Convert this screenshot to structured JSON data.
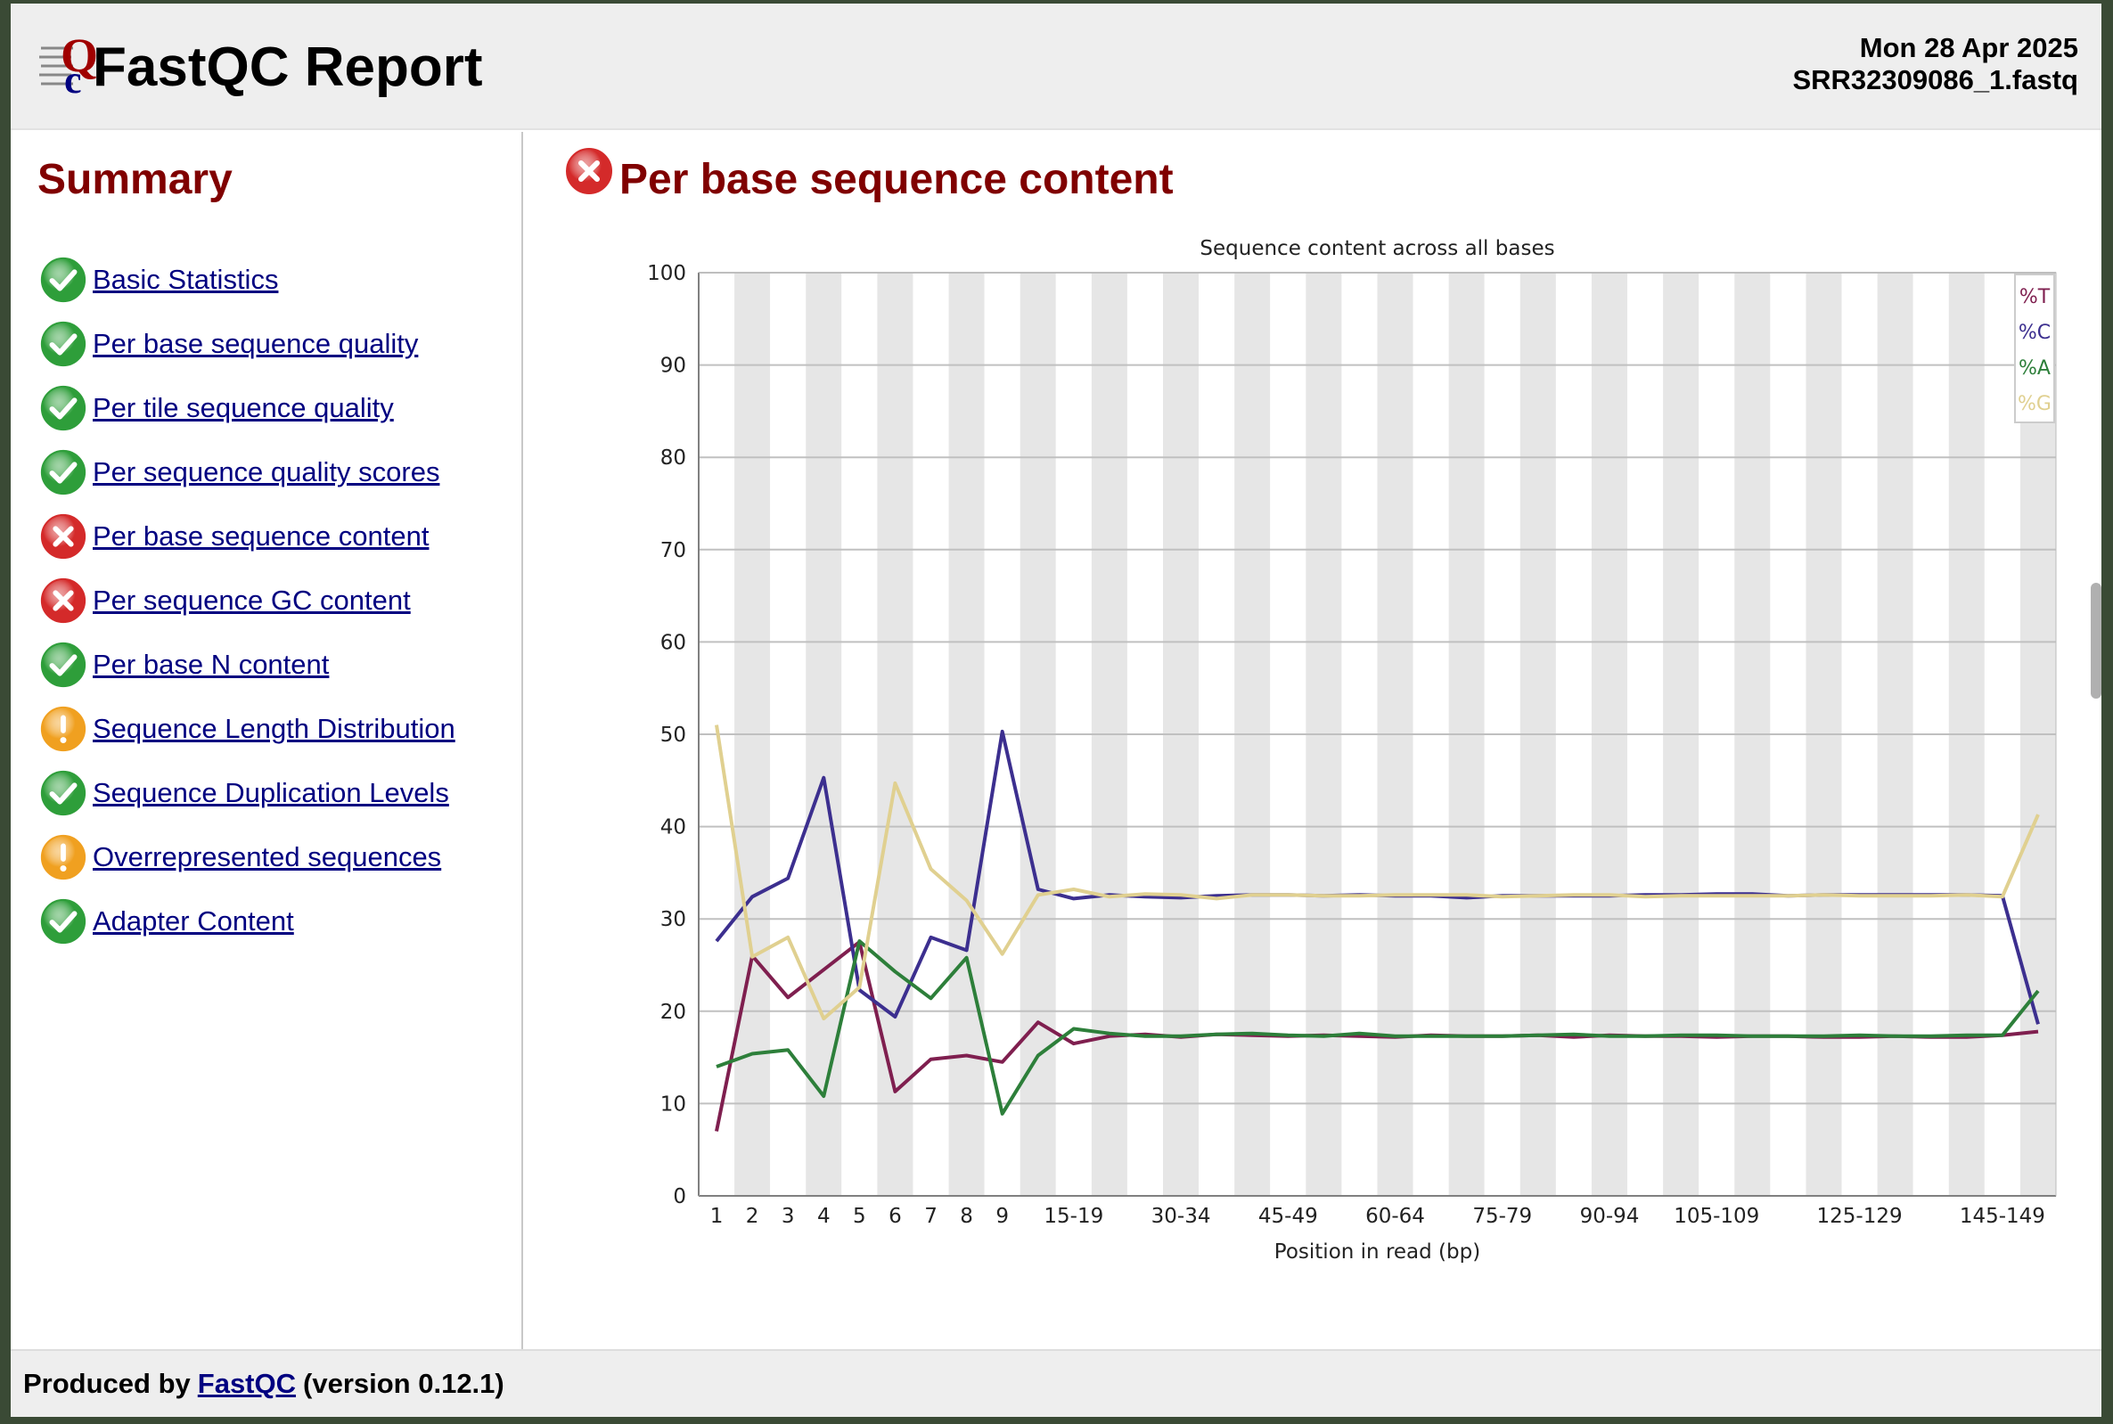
{
  "header": {
    "title": "FastQC Report",
    "date": "Mon 28 Apr 2025",
    "filename": "SRR32309086_1.fastq"
  },
  "sidebar": {
    "title": "Summary",
    "items": [
      {
        "label": "Basic Statistics",
        "status": "pass"
      },
      {
        "label": "Per base sequence quality",
        "status": "pass"
      },
      {
        "label": "Per tile sequence quality",
        "status": "pass"
      },
      {
        "label": "Per sequence quality scores",
        "status": "pass"
      },
      {
        "label": "Per base sequence content",
        "status": "fail"
      },
      {
        "label": "Per sequence GC content",
        "status": "fail"
      },
      {
        "label": "Per base N content",
        "status": "pass"
      },
      {
        "label": "Sequence Length Distribution",
        "status": "warn"
      },
      {
        "label": "Sequence Duplication Levels",
        "status": "pass"
      },
      {
        "label": "Overrepresented sequences",
        "status": "warn"
      },
      {
        "label": "Adapter Content",
        "status": "pass"
      }
    ]
  },
  "module": {
    "title": "Per base sequence content",
    "status": "fail"
  },
  "footer": {
    "produced_by": "Produced by",
    "link": "FastQC",
    "version": "(version 0.12.1)"
  },
  "colors": {
    "pass": "#2e9e3a",
    "fail": "#d42a2a",
    "warn": "#f0a020",
    "T": "#7f1f4f",
    "C": "#3c2f8f",
    "A": "#2d7f3a",
    "G": "#e0d090"
  },
  "chart_data": {
    "type": "line",
    "title": "Sequence content across all bases",
    "xlabel": "Position in read (bp)",
    "ylabel": "",
    "ylim": [
      0,
      100
    ],
    "yticks": [
      0,
      10,
      20,
      30,
      40,
      50,
      60,
      70,
      80,
      90,
      100
    ],
    "grid": true,
    "legend": "top-right",
    "categories": [
      "1",
      "2",
      "3",
      "4",
      "5",
      "6",
      "7",
      "8",
      "9",
      "10-14",
      "15-19",
      "20-24",
      "25-29",
      "30-34",
      "35-39",
      "40-44",
      "45-49",
      "50-54",
      "55-59",
      "60-64",
      "65-69",
      "70-74",
      "75-79",
      "80-84",
      "85-89",
      "90-94",
      "95-99",
      "100-104",
      "105-109",
      "110-114",
      "115-119",
      "120-124",
      "125-129",
      "130-134",
      "135-139",
      "140-144",
      "145-149",
      "150-151"
    ],
    "tick_labels": [
      "1",
      "2",
      "3",
      "4",
      "5",
      "6",
      "7",
      "8",
      "9",
      "",
      "15-19",
      "",
      "30-34",
      "",
      "45-49",
      "",
      "60-64",
      "",
      "75-79",
      "",
      "90-94",
      "",
      "105-109",
      "",
      "125-129",
      "",
      "145-149"
    ],
    "tick_at": [
      "1",
      "2",
      "3",
      "4",
      "5",
      "6",
      "7",
      "8",
      "9",
      "10-14",
      "15-19",
      "25-29",
      "30-34",
      "40-44",
      "45-49",
      "55-59",
      "60-64",
      "70-74",
      "75-79",
      "85-89",
      "90-94",
      "100-104",
      "105-109",
      "115-119",
      "125-129",
      "135-139",
      "145-149"
    ],
    "series": [
      {
        "name": "%T",
        "color": "#7f1f4f",
        "values": [
          7.0,
          26.0,
          21.5,
          24.5,
          27.5,
          11.3,
          14.8,
          15.2,
          14.5,
          18.8,
          16.5,
          17.3,
          17.5,
          17.2,
          17.5,
          17.4,
          17.3,
          17.4,
          17.3,
          17.2,
          17.4,
          17.3,
          17.3,
          17.4,
          17.2,
          17.4,
          17.3,
          17.3,
          17.2,
          17.3,
          17.3,
          17.2,
          17.2,
          17.3,
          17.2,
          17.2,
          17.4,
          17.8
        ]
      },
      {
        "name": "%C",
        "color": "#3c2f8f",
        "values": [
          27.6,
          32.4,
          34.4,
          45.3,
          22.3,
          19.4,
          28.0,
          26.6,
          50.3,
          33.2,
          32.2,
          32.6,
          32.4,
          32.3,
          32.5,
          32.6,
          32.6,
          32.5,
          32.6,
          32.5,
          32.5,
          32.3,
          32.5,
          32.5,
          32.5,
          32.5,
          32.6,
          32.6,
          32.7,
          32.7,
          32.5,
          32.6,
          32.6,
          32.6,
          32.6,
          32.6,
          32.5,
          18.6
        ]
      },
      {
        "name": "%A",
        "color": "#2d7f3a",
        "values": [
          14.0,
          15.4,
          15.8,
          10.8,
          27.6,
          24.3,
          21.4,
          25.8,
          8.9,
          15.2,
          18.1,
          17.6,
          17.3,
          17.3,
          17.5,
          17.6,
          17.4,
          17.3,
          17.6,
          17.3,
          17.3,
          17.3,
          17.3,
          17.4,
          17.5,
          17.3,
          17.3,
          17.4,
          17.4,
          17.3,
          17.3,
          17.3,
          17.4,
          17.3,
          17.3,
          17.4,
          17.4,
          22.2
        ]
      },
      {
        "name": "%G",
        "color": "#e0d090",
        "values": [
          51.0,
          25.9,
          28.0,
          19.2,
          22.6,
          44.7,
          35.4,
          32.0,
          26.2,
          32.6,
          33.2,
          32.4,
          32.7,
          32.6,
          32.2,
          32.6,
          32.6,
          32.5,
          32.5,
          32.6,
          32.6,
          32.6,
          32.4,
          32.5,
          32.6,
          32.6,
          32.4,
          32.5,
          32.5,
          32.5,
          32.5,
          32.6,
          32.5,
          32.5,
          32.5,
          32.6,
          32.4,
          41.3
        ]
      }
    ]
  }
}
